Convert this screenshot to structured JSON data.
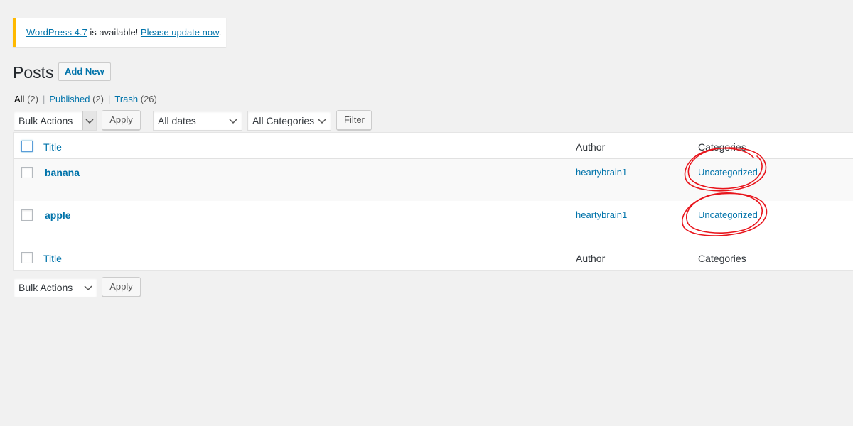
{
  "notice": {
    "version_link": "WordPress 4.7",
    "middle_text": " is available! ",
    "update_link": "Please update now",
    "end_text": "."
  },
  "header": {
    "title": "Posts",
    "add_new_label": "Add New"
  },
  "filters": {
    "all_label": "All",
    "all_count": "(2)",
    "published_label": "Published",
    "published_count": "(2)",
    "trash_label": "Trash",
    "trash_count": "(26)",
    "sep": "|"
  },
  "toolbar_top": {
    "bulk_actions": "Bulk Actions",
    "apply_label": "Apply",
    "dates": "All dates",
    "categories": "All Categories",
    "filter_label": "Filter"
  },
  "table": {
    "columns": {
      "title": "Title",
      "author": "Author",
      "categories": "Categories"
    },
    "rows": [
      {
        "title": "banana",
        "author": "heartybrain1",
        "category": "Uncategorized"
      },
      {
        "title": "apple",
        "author": "heartybrain1",
        "category": "Uncategorized"
      }
    ]
  },
  "toolbar_bottom": {
    "bulk_actions": "Bulk Actions",
    "apply_label": "Apply"
  },
  "colors": {
    "link": "#0073aa",
    "notice_accent": "#ffb900",
    "annotation": "#e8141b"
  },
  "icons": {
    "dropdown": "chevron-down-icon"
  }
}
